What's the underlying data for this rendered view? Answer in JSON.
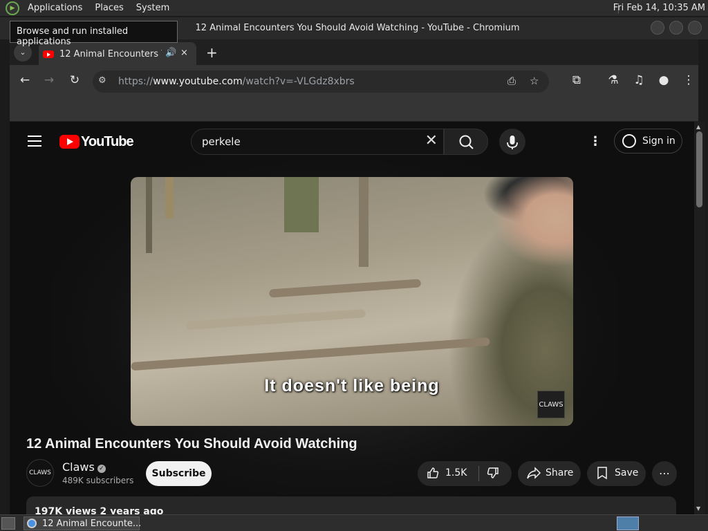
{
  "top_panel": {
    "menus": [
      "Applications",
      "Places",
      "System"
    ],
    "clock": "Fri Feb 14, 10:35 AM"
  },
  "tooltip": {
    "text": "Browse and run installed applications"
  },
  "window": {
    "title": "12 Animal Encounters You Should Avoid Watching - YouTube - Chromium"
  },
  "tab": {
    "title": "12 Animal Encounters You Should Avoid Watching",
    "close_icon": "×",
    "audio_icon": "🔊",
    "new_tab_icon": "+",
    "list_icon": "⌄"
  },
  "toolbar": {
    "url_scheme": "https://",
    "url_host": "www.youtube.com",
    "url_path": "/watch?v=-VLGdz8xbrs"
  },
  "youtube": {
    "logo_text": "YouTube",
    "search_value": "perkele",
    "sign_in": "Sign in",
    "video": {
      "subtitle": "It doesn't like being",
      "watermark": "CLAWS"
    },
    "title": "12 Animal Encounters You Should Avoid Watching",
    "channel": {
      "name": "Claws",
      "avatar_text": "CLAWS",
      "subscribers": "489K subscribers",
      "verified_icon": "✓"
    },
    "subscribe": "Subscribe",
    "likes": "1.5K",
    "share": "Share",
    "save": "Save",
    "more": "⋯",
    "description": "197K views  2 years ago"
  },
  "taskbar": {
    "items": [
      {
        "label": "12 Animal Encounte..."
      }
    ]
  },
  "colors": {
    "accent": "#ff0000",
    "page_bg": "#0f0f0f",
    "pill_bg": "#272727"
  }
}
